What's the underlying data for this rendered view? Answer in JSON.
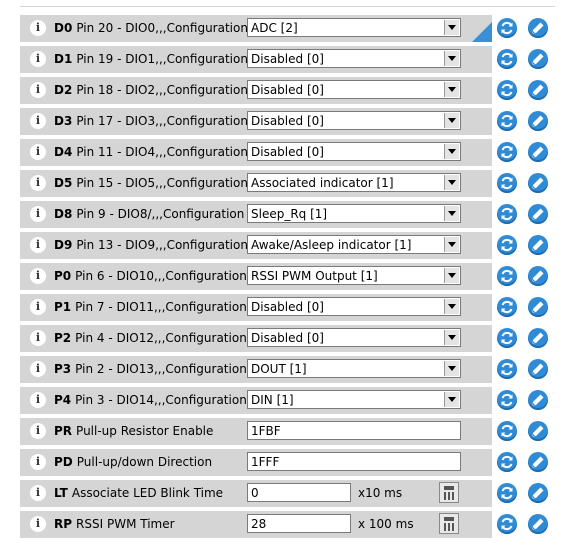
{
  "rows": [
    {
      "code": "D0",
      "desc": "Pin 20 - DIO0,,,Configuration",
      "type": "select",
      "value": "ADC [2]",
      "unit": ""
    },
    {
      "code": "D1",
      "desc": "Pin 19 - DIO1,,,Configuration",
      "type": "select",
      "value": "Disabled [0]",
      "unit": ""
    },
    {
      "code": "D2",
      "desc": "Pin 18 - DIO2,,,Configuration",
      "type": "select",
      "value": "Disabled [0]",
      "unit": ""
    },
    {
      "code": "D3",
      "desc": "Pin 17 - DIO3,,,Configuration",
      "type": "select",
      "value": "Disabled [0]",
      "unit": ""
    },
    {
      "code": "D4",
      "desc": "Pin 11 - DIO4,,,Configuration",
      "type": "select",
      "value": "Disabled [0]",
      "unit": ""
    },
    {
      "code": "D5",
      "desc": "Pin 15 - DIO5,,,Configuration",
      "type": "select",
      "value": "Associated indicator [1]",
      "unit": ""
    },
    {
      "code": "D8",
      "desc": "Pin 9 - DIO8/,,,Configuration",
      "type": "select",
      "value": "Sleep_Rq [1]",
      "unit": ""
    },
    {
      "code": "D9",
      "desc": "Pin 13 - DIO9,,,Configuration",
      "type": "select",
      "value": "Awake/Asleep indicator [1]",
      "unit": ""
    },
    {
      "code": "P0",
      "desc": "Pin 6 - DIO10,,,Configuration",
      "type": "select",
      "value": "RSSI PWM Output [1]",
      "unit": ""
    },
    {
      "code": "P1",
      "desc": "Pin 7 - DIO11,,,Configuration",
      "type": "select",
      "value": "Disabled [0]",
      "unit": ""
    },
    {
      "code": "P2",
      "desc": "Pin 4 - DIO12,,,Configuration",
      "type": "select",
      "value": "Disabled [0]",
      "unit": ""
    },
    {
      "code": "P3",
      "desc": "Pin 2 - DIO13,,,Configuration",
      "type": "select",
      "value": "DOUT [1]",
      "unit": ""
    },
    {
      "code": "P4",
      "desc": "Pin 3 - DIO14,,,Configuration",
      "type": "select",
      "value": "DIN [1]",
      "unit": ""
    },
    {
      "code": "PR",
      "desc": "Pull-up Resistor Enable",
      "type": "input",
      "value": "1FBF",
      "unit": ""
    },
    {
      "code": "PD",
      "desc": "Pull-up/down Direction",
      "type": "input",
      "value": "1FFF",
      "unit": ""
    },
    {
      "code": "LT",
      "desc": "Associate LED Blink Time",
      "type": "input-short",
      "value": "0",
      "unit": "x10 ms"
    },
    {
      "code": "RP",
      "desc": "RSSI PWM Timer",
      "type": "input-short",
      "value": "28",
      "unit": "x 100 ms"
    }
  ],
  "info_glyph": "i",
  "icons": {
    "read": "refresh-icon",
    "write": "pencil-icon"
  },
  "colors": {
    "row_bg": "#d5d5d5",
    "accent": "#2f8bd6",
    "changed_marker": "#3a8fd6"
  }
}
